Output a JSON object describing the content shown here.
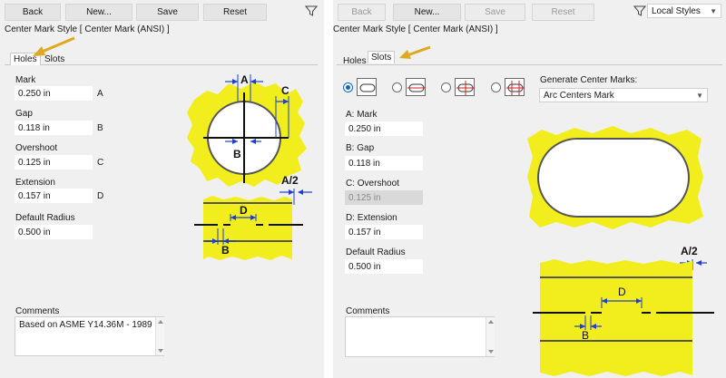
{
  "left": {
    "toolbar": {
      "back": "Back",
      "new": "New...",
      "save": "Save",
      "reset": "Reset"
    },
    "style_title": "Center Mark Style [ Center Mark (ANSI) ]",
    "tabs": [
      {
        "label": "Holes",
        "active": true
      },
      {
        "label": "Slots",
        "active": false
      }
    ],
    "fields": [
      {
        "label": "Mark",
        "value": "0.250 in",
        "letter": "A"
      },
      {
        "label": "Gap",
        "value": "0.118 in",
        "letter": "B"
      },
      {
        "label": "Overshoot",
        "value": "0.125 in",
        "letter": "C"
      },
      {
        "label": "Extension",
        "value": "0.157 in",
        "letter": "D"
      },
      {
        "label": "Default Radius",
        "value": "0.500 in",
        "letter": ""
      }
    ],
    "comments_label": "Comments",
    "comments_value": "Based on ASME Y14.36M - 1989",
    "diagram_labels": {
      "a": "A",
      "b": "B",
      "c": "C",
      "d": "D",
      "a_half": "A/2"
    }
  },
  "right": {
    "toolbar": {
      "back": "Back",
      "new": "New...",
      "save": "Save",
      "reset": "Reset"
    },
    "local_styles": "Local Styles",
    "style_title": "Center Mark Style [ Center Mark (ANSI) ]",
    "tabs": [
      {
        "label": "Holes",
        "active": false
      },
      {
        "label": "Slots",
        "active": true
      }
    ],
    "generate_label": "Generate Center Marks:",
    "generate_value": "Arc Centers Mark",
    "fields": [
      {
        "label": "A: Mark",
        "value": "0.250 in",
        "disabled": false
      },
      {
        "label": "B: Gap",
        "value": "0.118 in",
        "disabled": false
      },
      {
        "label": "C: Overshoot",
        "value": "0.125 in",
        "disabled": true
      },
      {
        "label": "D: Extension",
        "value": "0.157 in",
        "disabled": false
      },
      {
        "label": "Default Radius",
        "value": "0.500 in",
        "disabled": false
      }
    ],
    "comments_label": "Comments",
    "comments_value": "",
    "diagram_labels": {
      "a_half": "A/2",
      "d": "D",
      "b": "B"
    }
  },
  "colors": {
    "yellow": "#f2ee1e",
    "blue": "#1f3fd1",
    "radio": "#0a64c8",
    "arrow": "#e0a820"
  }
}
